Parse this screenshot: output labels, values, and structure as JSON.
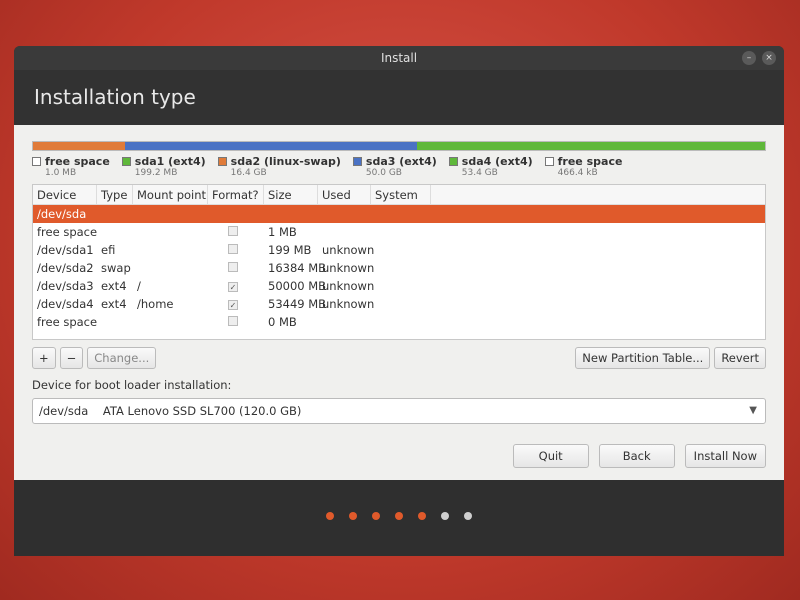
{
  "window": {
    "title": "Install",
    "heading": "Installation type"
  },
  "title_controls": {
    "minimize": "–",
    "close": "×"
  },
  "partition_bar": {
    "segments": [
      {
        "color": "#e07b39",
        "fraction": 0.125
      },
      {
        "color": "#4a72c4",
        "fraction": 0.4
      },
      {
        "color": "#5fb83a",
        "fraction": 0.475
      }
    ]
  },
  "legend": [
    {
      "label": "free space",
      "size": "1.0 MB",
      "color": "#ffffff"
    },
    {
      "label": "sda1 (ext4)",
      "size": "199.2 MB",
      "color": "#5fb83a"
    },
    {
      "label": "sda2 (linux-swap)",
      "size": "16.4 GB",
      "color": "#e07b39"
    },
    {
      "label": "sda3 (ext4)",
      "size": "50.0 GB",
      "color": "#4a72c4"
    },
    {
      "label": "sda4 (ext4)",
      "size": "53.4 GB",
      "color": "#5fb83a"
    },
    {
      "label": "free space",
      "size": "466.4 kB",
      "color": "#ffffff"
    }
  ],
  "table": {
    "headers": [
      "Device",
      "Type",
      "Mount point",
      "Format?",
      "Size",
      "Used",
      "System"
    ],
    "rows": [
      {
        "device": "/dev/sda",
        "type": "",
        "mount": "",
        "format": "",
        "size": "",
        "used": "",
        "system": "",
        "selected": true
      },
      {
        "device": "free space",
        "type": "",
        "mount": "",
        "format": "",
        "size": "1 MB",
        "used": "",
        "system": ""
      },
      {
        "device": "/dev/sda1",
        "type": "efi",
        "mount": "",
        "format": "",
        "size": "199 MB",
        "used": "unknown",
        "system": ""
      },
      {
        "device": "/dev/sda2",
        "type": "swap",
        "mount": "",
        "format": "",
        "size": "16384 MB",
        "used": "unknown",
        "system": ""
      },
      {
        "device": "/dev/sda3",
        "type": "ext4",
        "mount": "/",
        "format": "✓",
        "size": "50000 MB",
        "used": "unknown",
        "system": ""
      },
      {
        "device": "/dev/sda4",
        "type": "ext4",
        "mount": "/home",
        "format": "✓",
        "size": "53449 MB",
        "used": "unknown",
        "system": ""
      },
      {
        "device": "free space",
        "type": "",
        "mount": "",
        "format": "",
        "size": "0 MB",
        "used": "",
        "system": ""
      }
    ]
  },
  "toolbar": {
    "add": "+",
    "remove": "−",
    "change": "Change...",
    "new_table": "New Partition Table...",
    "revert": "Revert"
  },
  "boot": {
    "label": "Device for boot loader installation:",
    "device": "/dev/sda",
    "description": "ATA Lenovo SSD SL700 (120.0 GB)",
    "arrow": "▼"
  },
  "actions": {
    "quit": "Quit",
    "back": "Back",
    "install": "Install Now"
  },
  "progress_dots": {
    "total": 7,
    "completed": 5,
    "active_color": "#e05a2b",
    "inactive_color": "#cfcfcf"
  }
}
